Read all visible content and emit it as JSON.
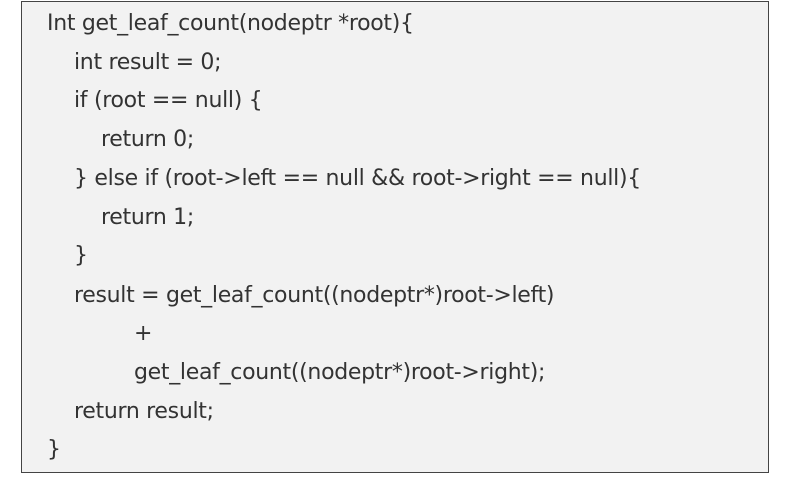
{
  "code": {
    "lines": [
      "Int get_leaf_count(nodeptr *root){",
      "int result = 0;",
      "if (root == null) {",
      "return 0;",
      "} else if (root->left == null && root->right == null){",
      "return 1;",
      "}",
      "result = get_leaf_count((nodeptr*)root->left)",
      "+",
      "get_leaf_count((nodeptr*)root->right);",
      "return result;",
      "}"
    ]
  }
}
